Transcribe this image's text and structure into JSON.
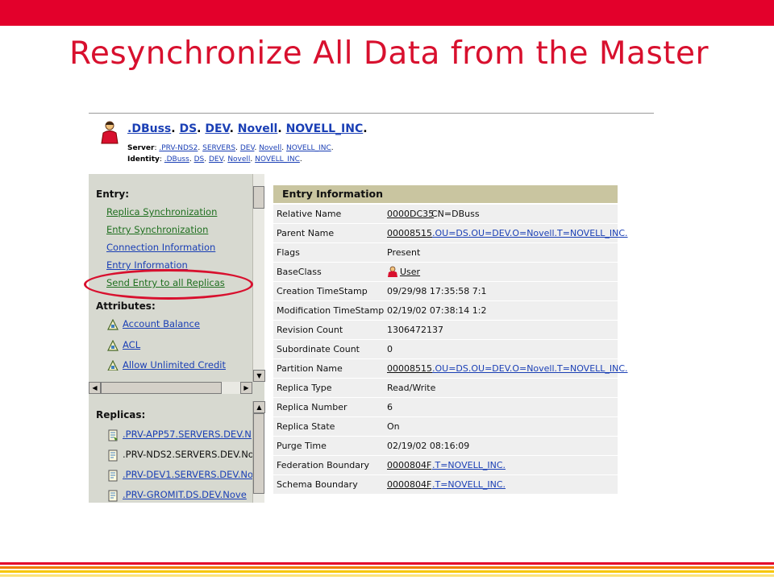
{
  "slide": {
    "title": "Resynchronize All Data from the Master",
    "accent_color": "#e3002b",
    "title_color": "#d8102e"
  },
  "header": {
    "object_parts": [
      ".DBuss",
      "DS",
      "DEV",
      "Novell",
      "NOVELL_INC"
    ],
    "server_label": "Server",
    "server_parts": [
      ".PRV-NDS2",
      "SERVERS",
      "DEV",
      "Novell",
      "NOVELL_INC"
    ],
    "identity_label": "Identity",
    "identity_parts": [
      ".DBuss",
      "DS",
      "DEV",
      "Novell",
      "NOVELL_INC"
    ],
    "icon": "user-person-icon"
  },
  "left_nav": {
    "entry_header": "Entry:",
    "entry_links": [
      "Replica Synchronization",
      "Entry Synchronization",
      "Connection Information",
      "Entry Information",
      "Send Entry to all Replicas"
    ],
    "attributes_header": "Attributes:",
    "attribute_links": [
      "Account Balance",
      "ACL",
      "Allow Unlimited Credit"
    ],
    "replicas_header": "Replicas:",
    "replica_items": [
      ".PRV-APP57.SERVERS.DEV.N",
      ".PRV-NDS2.SERVERS.DEV.No",
      ".PRV-DEV1.SERVERS.DEV.No",
      ".PRV-GROMIT.DS.DEV.Nove"
    ]
  },
  "entry_info": {
    "header": "Entry Information",
    "rows": [
      {
        "label": "Relative Name",
        "value": "0000DC35",
        "extra": "CN=DBuss"
      },
      {
        "label": "Parent Name",
        "value": "00008515",
        "extra": ".OU=DS.OU=DEV.O=Novell.T=NOVELL_INC."
      },
      {
        "label": "Flags",
        "value": "Present"
      },
      {
        "label": "BaseClass",
        "value": "User"
      },
      {
        "label": "Creation TimeStamp",
        "value": "09/29/98 17:35:58 7:1"
      },
      {
        "label": "Modification TimeStamp",
        "value": "02/19/02 07:38:14 1:2"
      },
      {
        "label": "Revision Count",
        "value": "1306472137"
      },
      {
        "label": "Subordinate Count",
        "value": "0"
      },
      {
        "label": "Partition Name",
        "value": "00008515",
        "extra": ".OU=DS.OU=DEV.O=Novell.T=NOVELL_INC."
      },
      {
        "label": "Replica Type",
        "value": "Read/Write"
      },
      {
        "label": "Replica Number",
        "value": "6"
      },
      {
        "label": "Replica State",
        "value": "On"
      },
      {
        "label": "Purge Time",
        "value": "02/19/02 08:16:09"
      },
      {
        "label": "Federation Boundary",
        "value": "0000804F",
        "extra": ".T=NOVELL_INC."
      },
      {
        "label": "Schema Boundary",
        "value": "0000804F",
        "extra": ".T=NOVELL_INC."
      }
    ]
  },
  "colors": {
    "nav_pane": "#d7d9d0",
    "info_header": "#c9c5a0",
    "row_bg": "#efefef",
    "link": "#1a3fb5",
    "nav_link_green": "#1f6f1f",
    "highlight_ellipse": "#d8102e"
  },
  "stripes": [
    "#e3002b",
    "#f07a00",
    "#f7c600",
    "#fbe27a"
  ]
}
